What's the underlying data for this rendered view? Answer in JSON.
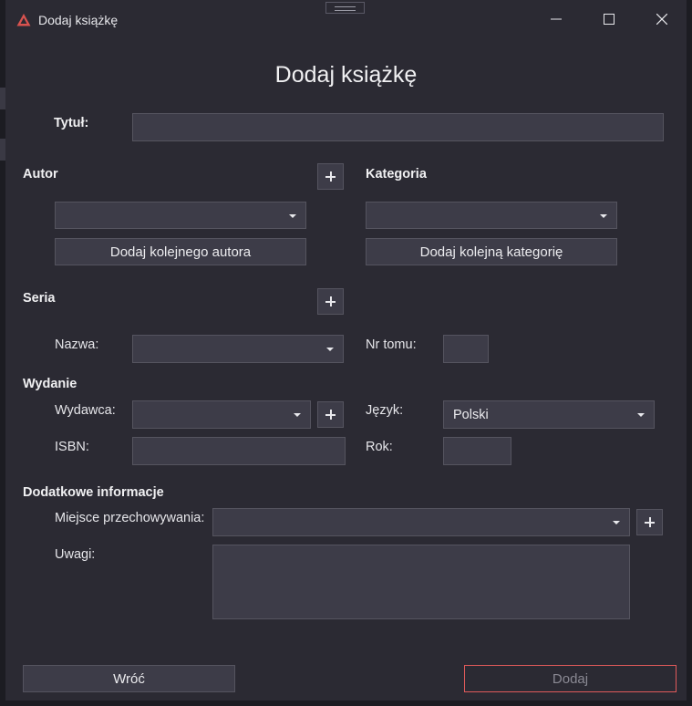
{
  "window": {
    "title": "Dodaj książkę"
  },
  "form": {
    "heading": "Dodaj książkę"
  },
  "title_label": "Tytuł:",
  "author": {
    "section": "Autor",
    "add_more_label": "Dodaj kolejnego autora"
  },
  "category": {
    "section": "Kategoria",
    "add_more_label": "Dodaj kolejną kategorię"
  },
  "series": {
    "section": "Seria",
    "name_label": "Nazwa:",
    "volume_label": "Nr tomu:"
  },
  "edition": {
    "section": "Wydanie",
    "publisher_label": "Wydawca:",
    "language_label": "Język:",
    "language_value": "Polski",
    "isbn_label": "ISBN:",
    "year_label": "Rok:"
  },
  "extra": {
    "section": "Dodatkowe informacje",
    "storage_label": "Miejsce przechowywania:",
    "notes_label": "Uwagi:"
  },
  "footer": {
    "back_label": "Wróć",
    "add_label": "Dodaj"
  },
  "colors": {
    "background": "#2b2a33",
    "field": "#3d3c48",
    "accent_border": "#e05a5a"
  }
}
